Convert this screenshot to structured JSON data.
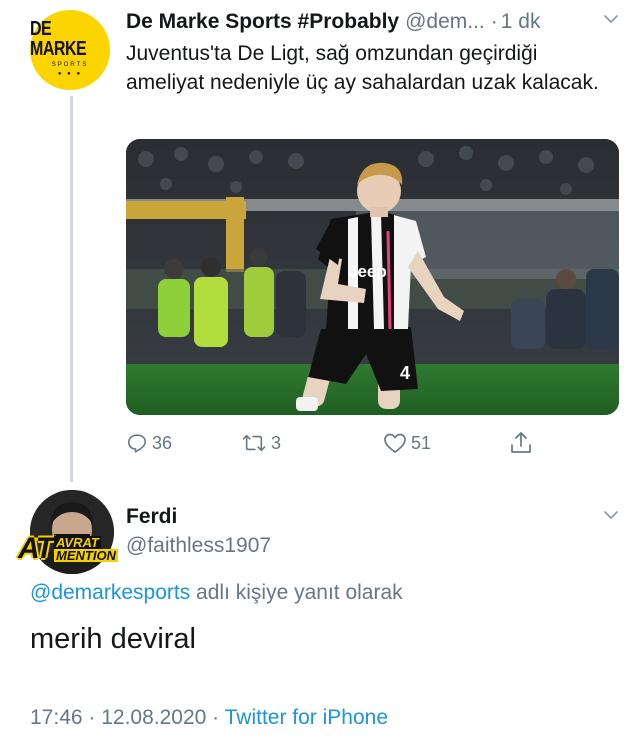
{
  "tweet": {
    "author_name": "De Marke Sports #Probably",
    "author_handle": "@dem...",
    "separator": "·",
    "time_ago": "1 dk",
    "text": "Juventus'ta De Ligt, sağ omzundan geçirdiği ameliyat nedeniyle üç ay sahalardan uzak kalacak.",
    "avatar": {
      "logo_text": "DE MARKE",
      "logo_sub": "SPORTS",
      "background": "#fcd400"
    },
    "photo": {
      "jersey_text": "Jeep",
      "number": "4"
    },
    "actions": {
      "replies": "36",
      "retweets": "3",
      "likes": "51"
    }
  },
  "reply": {
    "author_name": "Ferdi",
    "author_handle": "@faithless1907",
    "avatar_stamp": {
      "big": "AT",
      "top": "AVRAT",
      "bottom": "MENTION"
    },
    "replying_to_mention": "@demarkesports",
    "replying_suffix": " adlı kişiye yanıt olarak",
    "text": "merih deviral",
    "timestamp": "17:46 · 12.08.2020 · ",
    "source": "Twitter for iPhone"
  },
  "colors": {
    "secondary_text": "#657786",
    "link": "#1b95e0",
    "thread_line": "#cfd9de"
  },
  "icons": [
    "reply-icon",
    "retweet-icon",
    "like-icon",
    "share-icon",
    "chevron-down-icon"
  ]
}
